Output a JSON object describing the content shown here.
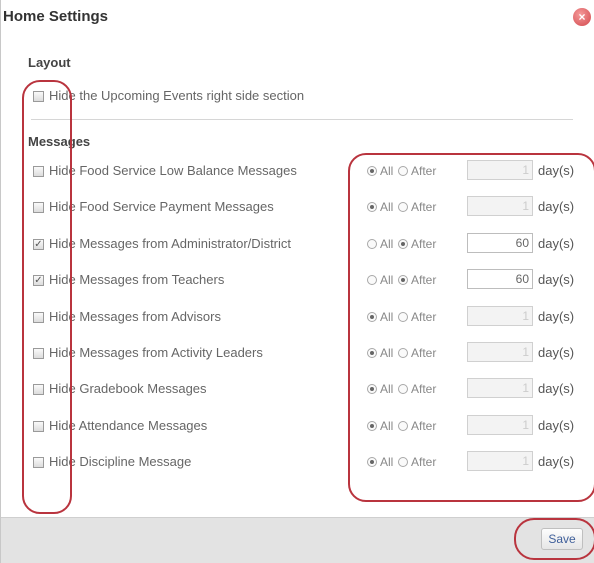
{
  "dialog": {
    "title": "Home Settings",
    "close_glyph": "×"
  },
  "layout": {
    "heading": "Layout",
    "option": {
      "label": "Hide the Upcoming Events right side section",
      "checked": false
    }
  },
  "messages": {
    "heading": "Messages",
    "items": [
      {
        "label": "Hide Food Service Low Balance Messages",
        "checked": false,
        "mode": "All",
        "days": "1"
      },
      {
        "label": "Hide Food Service Payment Messages",
        "checked": false,
        "mode": "All",
        "days": "1"
      },
      {
        "label": "Hide Messages from Administrator/District",
        "checked": true,
        "mode": "After",
        "days": "60"
      },
      {
        "label": "Hide Messages from Teachers",
        "checked": true,
        "mode": "After",
        "days": "60"
      },
      {
        "label": "Hide Messages from Advisors",
        "checked": false,
        "mode": "All",
        "days": "1"
      },
      {
        "label": "Hide Messages from Activity Leaders",
        "checked": false,
        "mode": "All",
        "days": "1"
      },
      {
        "label": "Hide Gradebook Messages",
        "checked": false,
        "mode": "All",
        "days": "1"
      },
      {
        "label": "Hide Attendance Messages",
        "checked": false,
        "mode": "All",
        "days": "1"
      },
      {
        "label": "Hide Discipline Message",
        "checked": false,
        "mode": "All",
        "days": "1"
      }
    ],
    "all_label": "All",
    "after_label": "After",
    "days_label": "day(s)"
  },
  "footer": {
    "save_label": "Save"
  },
  "colors": {
    "highlight": "#b9343e",
    "footer_bg": "#e3e3e3",
    "save_text": "#3f5f9a"
  }
}
